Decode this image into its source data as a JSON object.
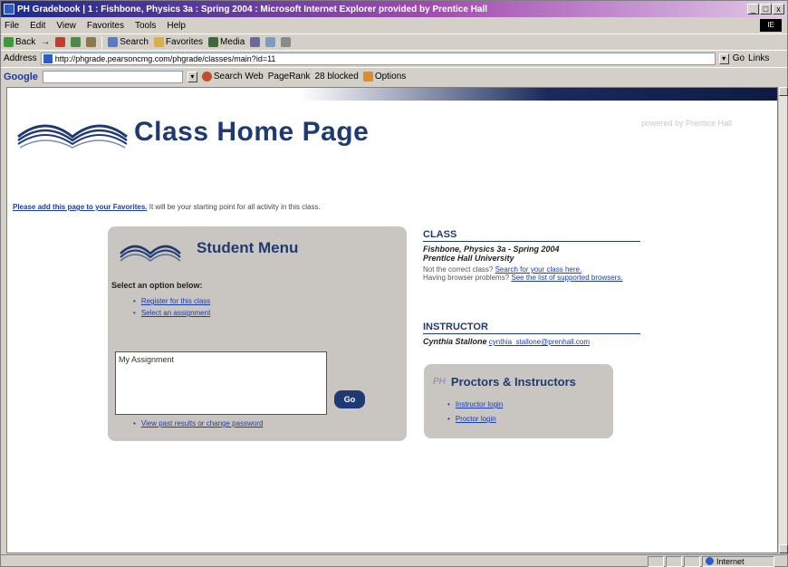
{
  "window": {
    "title": "PH Gradebook | 1 : Fishbone, Physics 3a : Spring 2004 : Microsoft Internet Explorer provided by Prentice Hall",
    "min_label": "_",
    "max_label": "□",
    "close_label": "x"
  },
  "menubar": {
    "items": [
      "File",
      "Edit",
      "View",
      "Favorites",
      "Tools",
      "Help"
    ],
    "throbber_label": "IE"
  },
  "toolbar": {
    "back": "Back",
    "forward": "→",
    "search": "Search",
    "favorites": "Favorites",
    "media": "Media"
  },
  "address": {
    "label": "Address",
    "url": "http://phgrade.pearsoncmg.com/phgrade/classes/main?id=11",
    "go_label": "Go",
    "links_label": "Links"
  },
  "google_bar": {
    "logo": "Google",
    "search_web": "Search Web",
    "pagerank": "PageRank",
    "blocked": "28 blocked",
    "options": "Options"
  },
  "page": {
    "title": "Class Home Page",
    "powered_by": "powered by Prentice Hall",
    "favorites_link": "Please add this page to your Favorites.",
    "favorites_rest": " It will be your starting point for all activity in this class."
  },
  "student_menu": {
    "title": "Student Menu",
    "select_label": "Select an option below:",
    "options": [
      "Register for this class",
      "Select an assignment"
    ],
    "assignment_box": "My Assignment",
    "go_button": "Go",
    "footer_link": "View past results or change password"
  },
  "class_info": {
    "heading": "CLASS",
    "class_name": "Fishbone, Physics 3a - Spring 2004",
    "school": "Prentice Hall University",
    "not_correct": "Not the correct class? ",
    "search_link": "Search for your class here.",
    "problems": "Having browser problems? ",
    "browsers_link": "See the list of supported browsers."
  },
  "instructor": {
    "heading": "INSTRUCTOR",
    "name": "Cynthia Stallone",
    "email": "cynthia_stallone@prenhall.com"
  },
  "prof_panel": {
    "badge": "PH",
    "title": "Proctors & Instructors",
    "links": [
      "Instructor login",
      "Proctor login"
    ]
  },
  "status": {
    "left": "",
    "zone": "Internet"
  },
  "colors": {
    "brand_navy": "#1f3a72",
    "panel_gray": "#c9c6c1",
    "link_blue": "#1a3cb0"
  }
}
